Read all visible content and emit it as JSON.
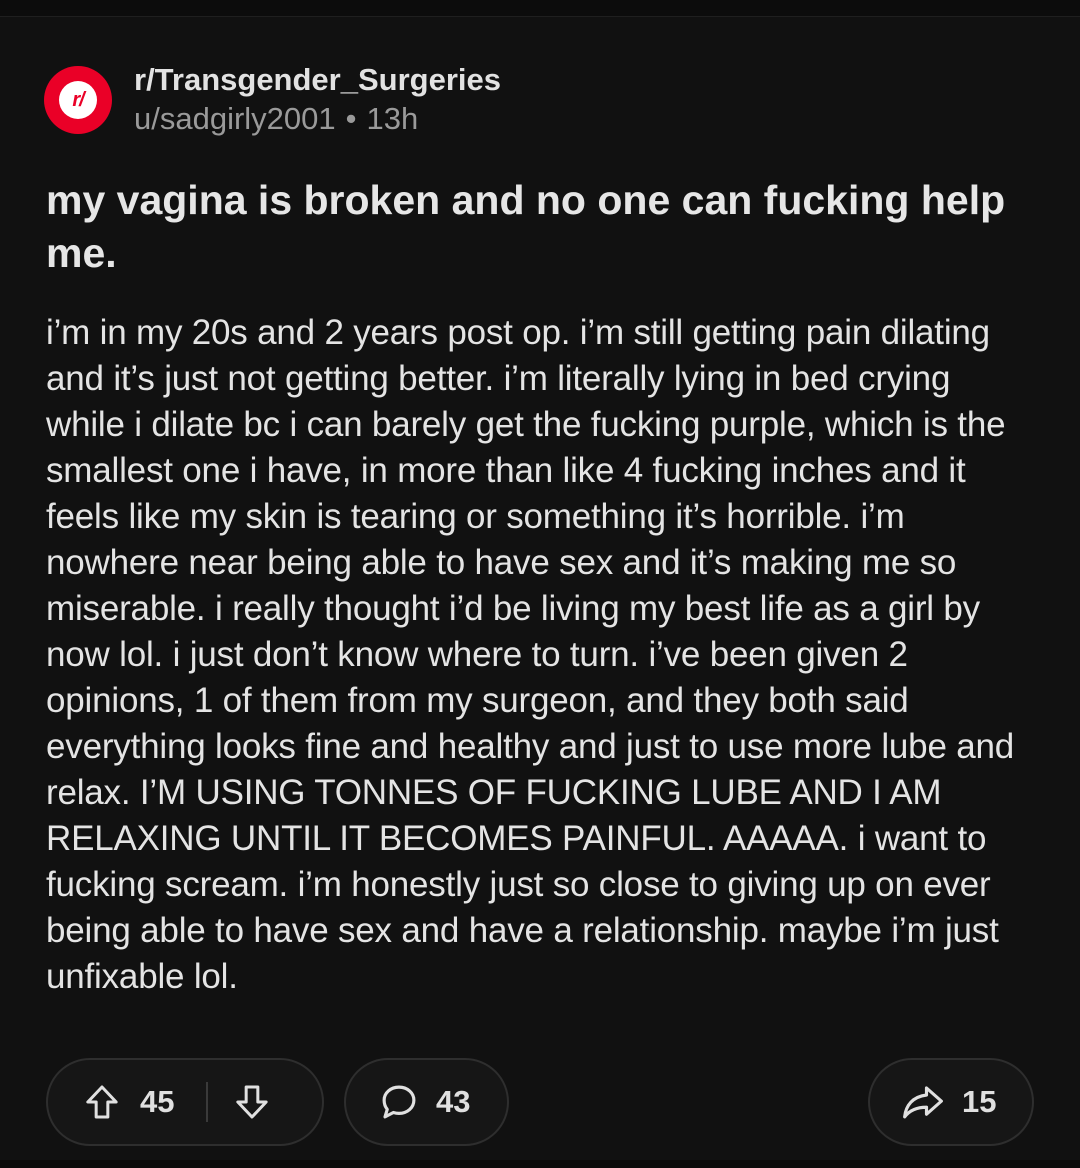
{
  "post": {
    "subreddit": "r/Transgender_Surgeries",
    "subreddit_icon": "subreddit-r-icon",
    "subreddit_icon_text": "r/",
    "author": "u/sadgirly2001",
    "separator": "•",
    "age": "13h",
    "title": "my vagina is broken and no one can fucking help me.",
    "body": "i’m in my 20s and 2 years post op. i’m still getting pain dilating and it’s just not getting better. i’m literally lying in bed crying while i dilate bc i can barely get the fucking purple, which is the smallest one i have, in more than like 4 fucking inches and it feels like my skin is tearing or something it’s horrible. i’m nowhere near being able to have sex and it’s making me so miserable. i really thought i’d be living my best life as a girl by now lol. i just don’t know where to turn. i’ve been given 2 opinions, 1 of them from my surgeon, and they both said everything looks fine and healthy and just to use more lube and relax. I’M USING TONNES OF FUCKING LUBE AND I AM RELAXING UNTIL IT BECOMES PAINFUL. AAAAA. i want to fucking scream. i’m honestly just so close to giving up on ever being able to have sex and have a relationship. maybe i’m just unfixable lol."
  },
  "actions": {
    "upvote_icon": "upvote-arrow-icon",
    "score": "45",
    "downvote_icon": "downvote-arrow-icon",
    "comment_icon": "comment-bubble-icon",
    "comments": "43",
    "share_icon": "share-arrow-icon",
    "shares": "15"
  },
  "colors": {
    "background": "#111111",
    "subreddit_icon": "#ea0027",
    "pill_border": "#2e2e2e",
    "muted_text": "#9a9a9a"
  }
}
